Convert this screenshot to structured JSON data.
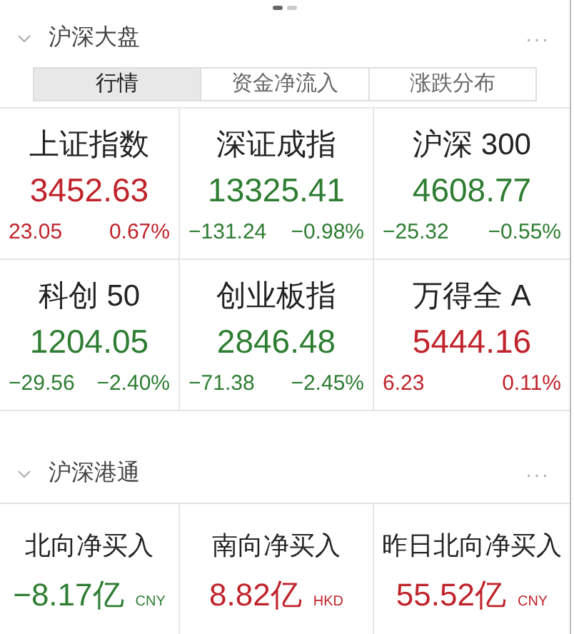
{
  "pager": [
    {
      "selected": true
    },
    {
      "selected": false
    }
  ],
  "sections": [
    {
      "title": "沪深大盘",
      "expanded": true,
      "more": "···",
      "tabs": [
        {
          "label": "行情",
          "selected": true
        },
        {
          "label": "资金净流入",
          "selected": false
        },
        {
          "label": "涨跌分布",
          "selected": false
        }
      ],
      "cards": [
        {
          "kind": "index",
          "name": "上证指数",
          "value": "3452.63",
          "change": "23.05",
          "percent": "0.67%",
          "color": "#c0232b"
        },
        {
          "kind": "index",
          "name": "深证成指",
          "value": "13325.41",
          "change": "−131.24",
          "percent": "−0.98%",
          "color": "#2e7d32"
        },
        {
          "kind": "index",
          "name": "沪深 300",
          "value": "4608.77",
          "change": "−25.32",
          "percent": "−0.55%",
          "color": "#2e7d32"
        },
        {
          "kind": "index",
          "name": "科创 50",
          "value": "1204.05",
          "change": "−29.56",
          "percent": "−2.40%",
          "color": "#2e7d32"
        },
        {
          "kind": "index",
          "name": "创业板指",
          "value": "2846.48",
          "change": "−71.38",
          "percent": "−2.45%",
          "color": "#2e7d32"
        },
        {
          "kind": "index",
          "name": "万得全 A",
          "value": "5444.16",
          "change": "6.23",
          "percent": "0.11%",
          "color": "#c0232b"
        }
      ]
    },
    {
      "title": "沪深港通",
      "expanded": true,
      "more": "···",
      "cards": [
        {
          "kind": "flow",
          "name": "北向净买入",
          "value": "−8.17亿",
          "currency": "CNY",
          "color": "#2e7d32"
        },
        {
          "kind": "flow",
          "name": "南向净买入",
          "value": "8.82亿",
          "currency": "HKD",
          "color": "#c0232b"
        },
        {
          "kind": "flow",
          "name": "昨日北向净买入",
          "value": "55.52亿",
          "currency": "CNY",
          "color": "#c0232b"
        }
      ]
    }
  ]
}
